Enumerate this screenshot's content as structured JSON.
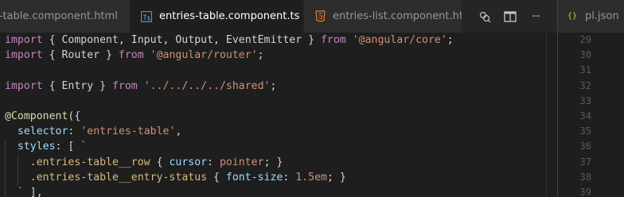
{
  "tabs": [
    {
      "label": "s-table.component.html",
      "icon": "html5-icon",
      "active": false
    },
    {
      "label": "entries-table.component.ts",
      "icon": "typescript-icon",
      "active": true
    },
    {
      "label": "entries-list.component.html",
      "icon": "html5-icon",
      "active": false
    }
  ],
  "close_glyph": "✕",
  "actions": {
    "more_label": "···"
  },
  "right_tab": {
    "icon_text": "{}",
    "label": "pl.json"
  },
  "right_line_numbers": [
    "29",
    "30",
    "31",
    "32",
    "33",
    "34",
    "35",
    "36",
    "37",
    "38",
    "39"
  ],
  "code_lines": [
    {
      "tokens": [
        {
          "t": "import",
          "c": "kw"
        },
        {
          "t": " { Component, Input, Output, EventEmitter } ",
          "c": "id"
        },
        {
          "t": "from",
          "c": "kw"
        },
        {
          "t": " ",
          "c": "id"
        },
        {
          "t": "'@angular/core'",
          "c": "str"
        },
        {
          "t": ";",
          "c": "id"
        }
      ]
    },
    {
      "tokens": [
        {
          "t": "import",
          "c": "kw"
        },
        {
          "t": " { Router } ",
          "c": "id"
        },
        {
          "t": "from",
          "c": "kw"
        },
        {
          "t": " ",
          "c": "id"
        },
        {
          "t": "'@angular/router'",
          "c": "str"
        },
        {
          "t": ";",
          "c": "id"
        }
      ]
    },
    {
      "tokens": []
    },
    {
      "tokens": [
        {
          "t": "import",
          "c": "kw"
        },
        {
          "t": " { Entry } ",
          "c": "id"
        },
        {
          "t": "from",
          "c": "kw"
        },
        {
          "t": " ",
          "c": "id"
        },
        {
          "t": "'../../../../shared'",
          "c": "str"
        },
        {
          "t": ";",
          "c": "id"
        }
      ]
    },
    {
      "tokens": []
    },
    {
      "tokens": [
        {
          "t": "@Component",
          "c": "dec"
        },
        {
          "t": "({",
          "c": "id"
        }
      ]
    },
    {
      "tokens": [
        {
          "t": "  ",
          "c": "id"
        },
        {
          "t": "selector",
          "c": "prop"
        },
        {
          "t": ": ",
          "c": "id"
        },
        {
          "t": "'entries-table'",
          "c": "str"
        },
        {
          "t": ",",
          "c": "id"
        }
      ]
    },
    {
      "tokens": [
        {
          "t": "  ",
          "c": "id"
        },
        {
          "t": "styles",
          "c": "prop"
        },
        {
          "t": ": [ ",
          "c": "id"
        },
        {
          "t": "`",
          "c": "str"
        }
      ]
    },
    {
      "tokens": [
        {
          "t": "    ",
          "c": "id"
        },
        {
          "t": ".entries-table__row",
          "c": "cls"
        },
        {
          "t": " { ",
          "c": "id"
        },
        {
          "t": "cursor",
          "c": "prop"
        },
        {
          "t": ": ",
          "c": "id"
        },
        {
          "t": "pointer",
          "c": "str"
        },
        {
          "t": "; }",
          "c": "id"
        }
      ]
    },
    {
      "tokens": [
        {
          "t": "    ",
          "c": "id"
        },
        {
          "t": ".entries-table__entry-status",
          "c": "cls"
        },
        {
          "t": " { ",
          "c": "id"
        },
        {
          "t": "font-size",
          "c": "prop"
        },
        {
          "t": ": ",
          "c": "id"
        },
        {
          "t": "1.5em",
          "c": "str"
        },
        {
          "t": "; }",
          "c": "id"
        }
      ]
    },
    {
      "tokens": [
        {
          "t": "  ",
          "c": "id"
        },
        {
          "t": "`",
          "c": "str"
        },
        {
          "t": " ],",
          "c": "id"
        }
      ]
    }
  ]
}
